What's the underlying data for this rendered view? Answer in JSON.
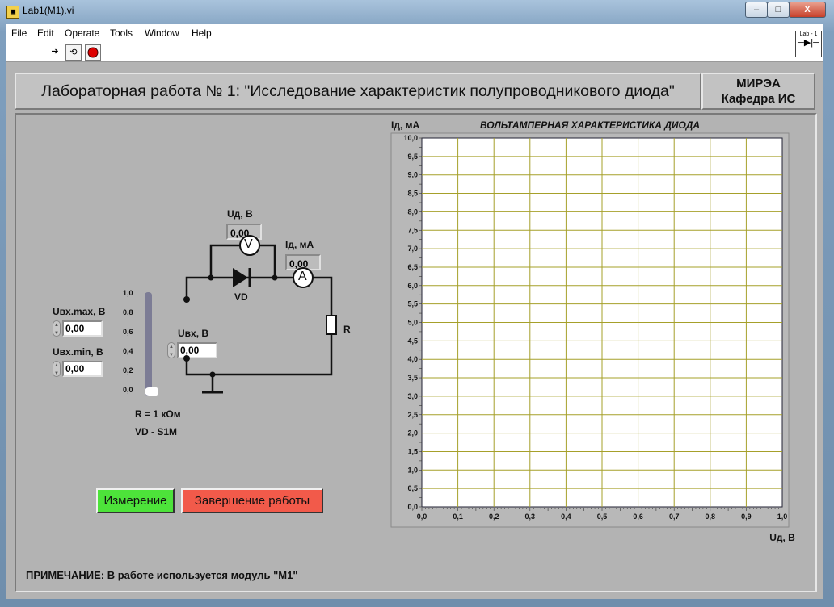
{
  "window": {
    "title": "Lab1(M1).vi",
    "minimize": "–",
    "maximize": "□",
    "close": "X"
  },
  "menu": [
    "File",
    "Edit",
    "Operate",
    "Tools",
    "Window",
    "Help"
  ],
  "toolbar": {
    "icons": [
      "run-arrow-icon",
      "run-continuous-icon",
      "abort-stop-icon"
    ],
    "lab_icon_label": "Lab - 1"
  },
  "header": {
    "title": "Лабораторная работа № 1: \"Исследование характеристик полупроводникового диода\"",
    "org_line1": "МИРЭА",
    "org_line2": "Кафедра ИС"
  },
  "controls": {
    "uin_max_label": "Uвх.max, В",
    "uin_max_value": "0,00",
    "uin_min_label": "Uвх.min, В",
    "uin_min_value": "0,00",
    "uin_label": "Uвх, В",
    "uin_value": "0,00",
    "ud_label": "Uд, В",
    "ud_value": "0,00",
    "id_label": "Iд, мА",
    "id_value": "0,00",
    "slider_ticks": [
      "1,0",
      "0,8",
      "0,6",
      "0,4",
      "0,2",
      "0,0"
    ],
    "slider_level": 0
  },
  "circuit": {
    "voltmeter": "V",
    "ammeter": "A",
    "diode_label": "VD",
    "resistor_label": "R",
    "r_value": "R = 1 кОм",
    "vd_model": "VD - S1M"
  },
  "buttons": {
    "measure": "Измерение",
    "finish": "Завершение работы"
  },
  "note": "ПРИМЕЧАНИЕ: В работе используется модуль \"M1\"",
  "colors": {
    "measure_bg": "#4de33a",
    "finish_bg": "#f25a4a",
    "plot_grid": "#a6a02a"
  },
  "chart_data": {
    "type": "line",
    "title": "ВОЛЬТАМПЕРНАЯ  ХАРАКТЕРИСТИКА  ДИОДА",
    "xlabel": "Uд, В",
    "ylabel": "Iд, мА",
    "xlim": [
      0,
      1
    ],
    "ylim": [
      0,
      10
    ],
    "x_ticks": [
      "0,0",
      "0,1",
      "0,2",
      "0,3",
      "0,4",
      "0,5",
      "0,6",
      "0,7",
      "0,8",
      "0,9",
      "1,0"
    ],
    "y_ticks": [
      "0,0",
      "0,5",
      "1,0",
      "1,5",
      "2,0",
      "2,5",
      "3,0",
      "3,5",
      "4,0",
      "4,5",
      "5,0",
      "5,5",
      "6,0",
      "6,5",
      "7,0",
      "7,5",
      "8,0",
      "8,5",
      "9,0",
      "9,5",
      "10,0"
    ],
    "grid": true,
    "series": [
      {
        "x": [],
        "y": []
      }
    ]
  }
}
